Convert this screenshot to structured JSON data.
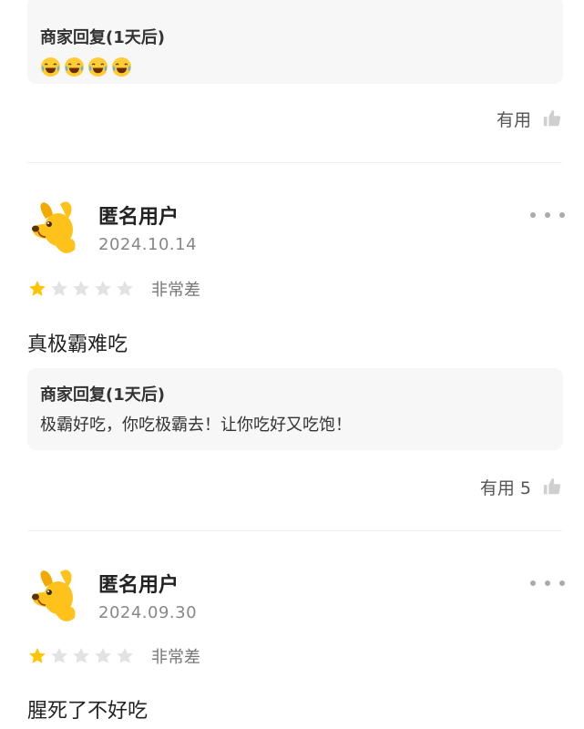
{
  "reply_top": {
    "title": "商家回复(1天后)",
    "emoji_icons": [
      "laughing-tears-icon",
      "laughing-tears-icon",
      "laughing-tears-icon",
      "laughing-tears-icon"
    ]
  },
  "useful_top": {
    "label": "有用"
  },
  "reviews": [
    {
      "username": "匿名用户",
      "date": "2024.10.14",
      "rating": 1,
      "max_rating": 5,
      "rating_label": "非常差",
      "text": "真极霸难吃",
      "reply": {
        "title": "商家回复(1天后)",
        "text": "极霸好吃，你吃极霸去！让你吃好又吃饱！"
      },
      "useful_label": "有用 5"
    },
    {
      "username": "匿名用户",
      "date": "2024.09.30",
      "rating": 1,
      "max_rating": 5,
      "rating_label": "非常差",
      "text": "腥死了不好吃"
    }
  ],
  "colors": {
    "star_filled": "#FFC400",
    "star_empty": "#E2E2E2",
    "reply_bg": "#F7F7F7",
    "avatar_dog": "#FFC21A"
  }
}
